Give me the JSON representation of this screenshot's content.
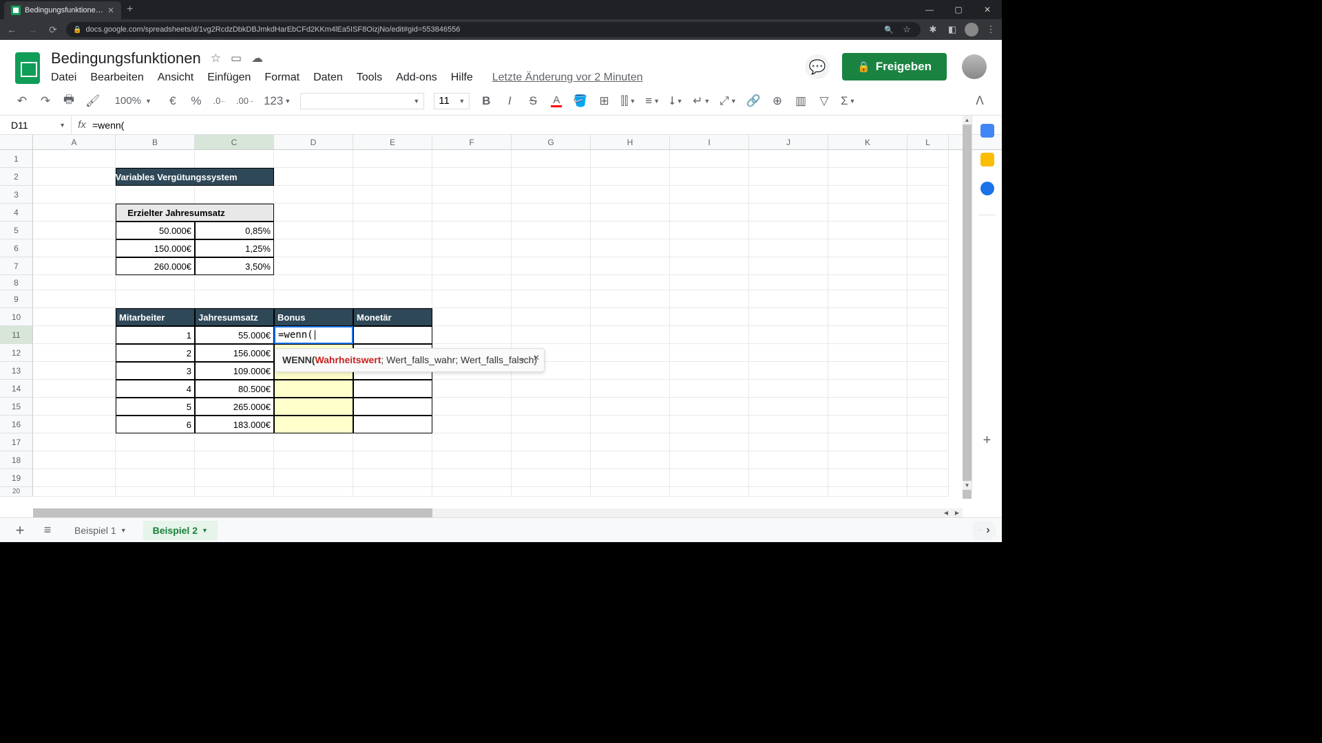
{
  "browser": {
    "tab_title": "Bedingungsfunktionen - Google",
    "url": "docs.google.com/spreadsheets/d/1vg2RcdzDbkDBJmkdHarEbCFd2KKm4lEa5ISF8OizjNo/edit#gid=553846556"
  },
  "doc_title": "Bedingungsfunktionen",
  "menus": [
    "Datei",
    "Bearbeiten",
    "Ansicht",
    "Einfügen",
    "Format",
    "Daten",
    "Tools",
    "Add-ons",
    "Hilfe"
  ],
  "last_edit": "Letzte Änderung vor 2 Minuten",
  "share_label": "Freigeben",
  "toolbar": {
    "zoom": "100%",
    "currency": "€",
    "percent": "%",
    "dec_dec": ".0",
    "inc_dec": ".00",
    "numfmt": "123",
    "font_size": "11"
  },
  "name_box": "D11",
  "formula_bar": "=wenn(",
  "columns": [
    "A",
    "B",
    "C",
    "D",
    "E",
    "F",
    "G",
    "H",
    "I",
    "J",
    "K",
    "L"
  ],
  "rows_visible": [
    1,
    2,
    3,
    4,
    5,
    6,
    7,
    8,
    9,
    10,
    11,
    12,
    13,
    14,
    15,
    16,
    17,
    18,
    19,
    20
  ],
  "headers": {
    "title1": "Variables Vergütungssystem",
    "title2": "Erzielter Jahresumsatz",
    "mitarbeiter": "Mitarbeiter",
    "jahresumsatz": "Jahresumsatz",
    "bonus": "Bonus",
    "monetar": "Monetär"
  },
  "threshold_table": [
    {
      "amount": "50.000€",
      "rate": "0,85%"
    },
    {
      "amount": "150.000€",
      "rate": "1,25%"
    },
    {
      "amount": "260.000€",
      "rate": "3,50%"
    }
  ],
  "employees": [
    {
      "id": "1",
      "revenue": "55.000€"
    },
    {
      "id": "2",
      "revenue": "156.000€"
    },
    {
      "id": "3",
      "revenue": "109.000€"
    },
    {
      "id": "4",
      "revenue": "80.500€"
    },
    {
      "id": "5",
      "revenue": "265.000€"
    },
    {
      "id": "6",
      "revenue": "183.000€"
    }
  ],
  "active_cell_formula": "=wenn(",
  "tooltip": {
    "fn": "WENN(",
    "arg1": "Wahrheitswert",
    "rest": "; Wert_falls_wahr; Wert_falls_falsch)"
  },
  "sheets": {
    "tab1": "Beispiel 1",
    "tab2": "Beispiel 2"
  }
}
